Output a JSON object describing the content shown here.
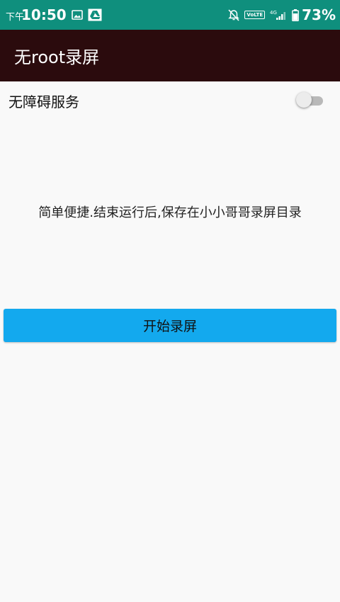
{
  "status_bar": {
    "time_prefix": "下午",
    "time": "10:50",
    "volte_label": "VoLTE",
    "network_label": "4G",
    "battery_percent": "73%",
    "icons": [
      "image-icon",
      "drive-icon",
      "bell-off-icon",
      "volte-icon",
      "signal-icon",
      "battery-icon"
    ]
  },
  "app_bar": {
    "title": "无root录屏"
  },
  "accessibility": {
    "label": "无障碍服务",
    "enabled": false
  },
  "description": "简单便捷.结束运行后,保存在小小哥哥录屏目录",
  "start_button": {
    "label": "开始录屏"
  },
  "colors": {
    "status_bar": "#0f8f7d",
    "app_bar": "#2b0b0d",
    "button": "#13a9ee",
    "background": "#f9f9f9"
  }
}
